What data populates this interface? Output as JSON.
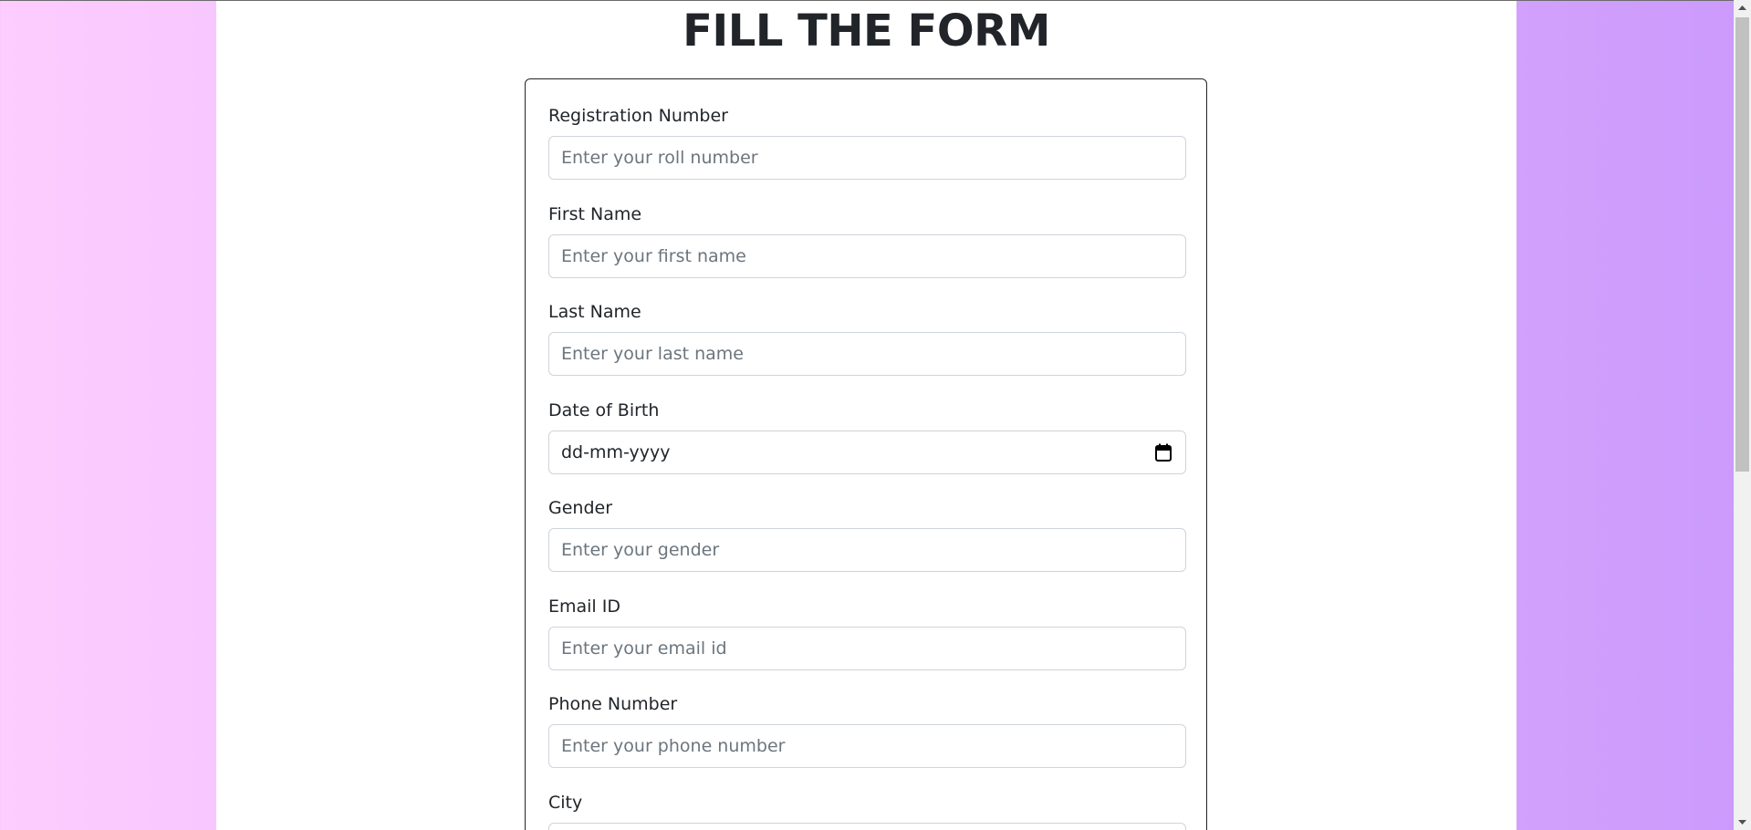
{
  "page": {
    "title": "FILL THE FORM"
  },
  "form": {
    "fields": [
      {
        "label": "Registration Number",
        "placeholder": "Enter your roll number"
      },
      {
        "label": "First Name",
        "placeholder": "Enter your first name"
      },
      {
        "label": "Last Name",
        "placeholder": "Enter your last name"
      },
      {
        "label": "Date of Birth",
        "placeholder": "dd-mm-yyyy"
      },
      {
        "label": "Gender",
        "placeholder": "Enter your gender"
      },
      {
        "label": "Email ID",
        "placeholder": "Enter your email id"
      },
      {
        "label": "Phone Number",
        "placeholder": "Enter your phone number"
      },
      {
        "label": "City",
        "placeholder": ""
      }
    ]
  },
  "icons": {
    "calendar": "calendar-icon",
    "scroll_up": "chevron-up-icon",
    "scroll_down": "chevron-down-icon"
  },
  "colors": {
    "gradient_left": "#fdcdff",
    "gradient_right": "#cb9afc",
    "text": "#212529",
    "placeholder": "#6c757d",
    "input_border": "#ced4da"
  }
}
